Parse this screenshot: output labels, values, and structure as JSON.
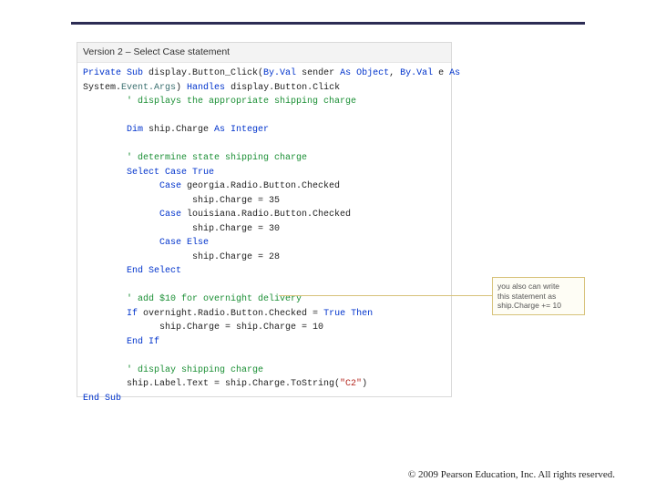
{
  "box_title": "Version 2 – Select Case statement",
  "code": {
    "l01a": "Private Sub",
    "l01b": " display.Button_Click(",
    "l01c": "By.Val",
    "l01d": " sender ",
    "l01e": "As Object",
    "l01f": ", ",
    "l01g": "By.Val",
    "l01h": " e ",
    "l01i": "As",
    "l02a": "System.",
    "l02b": "Event.Args",
    "l02c": ") ",
    "l02d": "Handles",
    "l02e": " display.Button.Click",
    "l03": "        ' displays the appropriate shipping charge",
    "l04": "",
    "l05a": "        Dim",
    "l05b": " ship.Charge ",
    "l05c": "As Integer",
    "l06": "",
    "l07": "        ' determine state shipping charge",
    "l08a": "        Select Case",
    "l08b": " ",
    "l08c": "True",
    "l09a": "              Case",
    "l09b": " georgia.Radio.Button.Checked",
    "l10": "                    ship.Charge = 35",
    "l11a": "              Case",
    "l11b": " louisiana.Radio.Button.Checked",
    "l12": "                    ship.Charge = 30",
    "l13": "              Case Else",
    "l14": "                    ship.Charge = 28",
    "l15": "        End Select",
    "l16": "",
    "l17": "        ' add $10 for overnight delivery",
    "l18a": "        If",
    "l18b": " overnight.Radio.Button.Checked = ",
    "l18c": "True",
    "l18d": " ",
    "l18e": "Then",
    "l19": "              ship.Charge = ship.Charge = 10",
    "l20": "        End If",
    "l21": "",
    "l22": "        ' display shipping charge",
    "l23a": "        ship.Label.Text = ship.Charge.ToString(",
    "l23b": "\"C2\"",
    "l23c": ")",
    "l24": "End Sub"
  },
  "note": {
    "l1": "you also can write",
    "l2": "this statement as",
    "l3": "ship.Charge += 10"
  },
  "copyright": "© 2009 Pearson Education, Inc.  All rights reserved."
}
